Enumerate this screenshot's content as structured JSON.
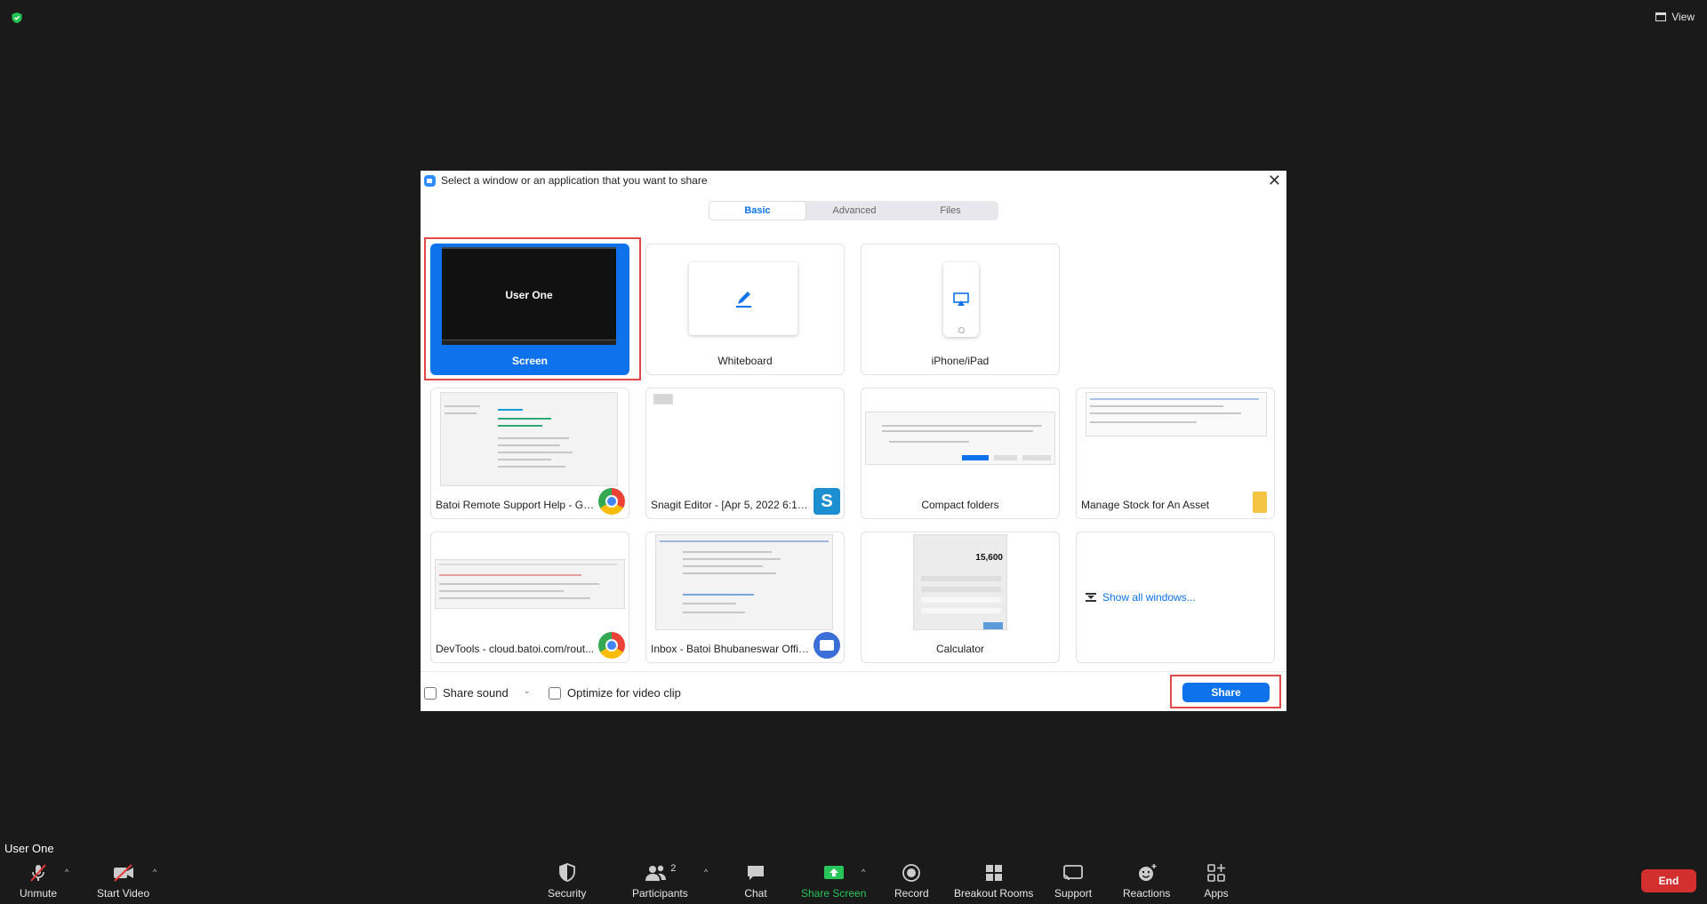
{
  "top": {
    "view_label": "View"
  },
  "user_name": "User One",
  "toolbar": {
    "unmute": "Unmute",
    "start_video": "Start Video",
    "security": "Security",
    "participants": "Participants",
    "participants_count": "2",
    "chat": "Chat",
    "share_screen": "Share Screen",
    "record": "Record",
    "breakout_rooms": "Breakout Rooms",
    "support": "Support",
    "reactions": "Reactions",
    "apps": "Apps",
    "end": "End"
  },
  "dialog": {
    "title": "Select a window or an application that you want to share",
    "tabs": [
      "Basic",
      "Advanced",
      "Files"
    ],
    "tiles": {
      "screen": {
        "label": "Screen",
        "preview_text": "User One"
      },
      "whiteboard": "Whiteboard",
      "iphone": "iPhone/iPad",
      "chrome_help": "Batoi Remote Support Help - Go...",
      "snagit": "Snagit Editor - [Apr 5, 2022 6:15:3...",
      "compact_folders": "Compact folders",
      "manage_stock": "Manage Stock for An Asset",
      "devtools": "DevTools - cloud.batoi.com/rout...",
      "inbox": "Inbox - Batoi Bhubaneswar Offic...",
      "calculator": "Calculator",
      "calculator_value": "15,600",
      "show_all": "Show all windows..."
    },
    "share_sound": "Share sound",
    "optimize": "Optimize for video clip",
    "share_button": "Share"
  },
  "colors": {
    "accent": "#0e72ed",
    "end": "#d32f2f",
    "share_screen": "#29c45a",
    "highlight": "#e34848"
  }
}
